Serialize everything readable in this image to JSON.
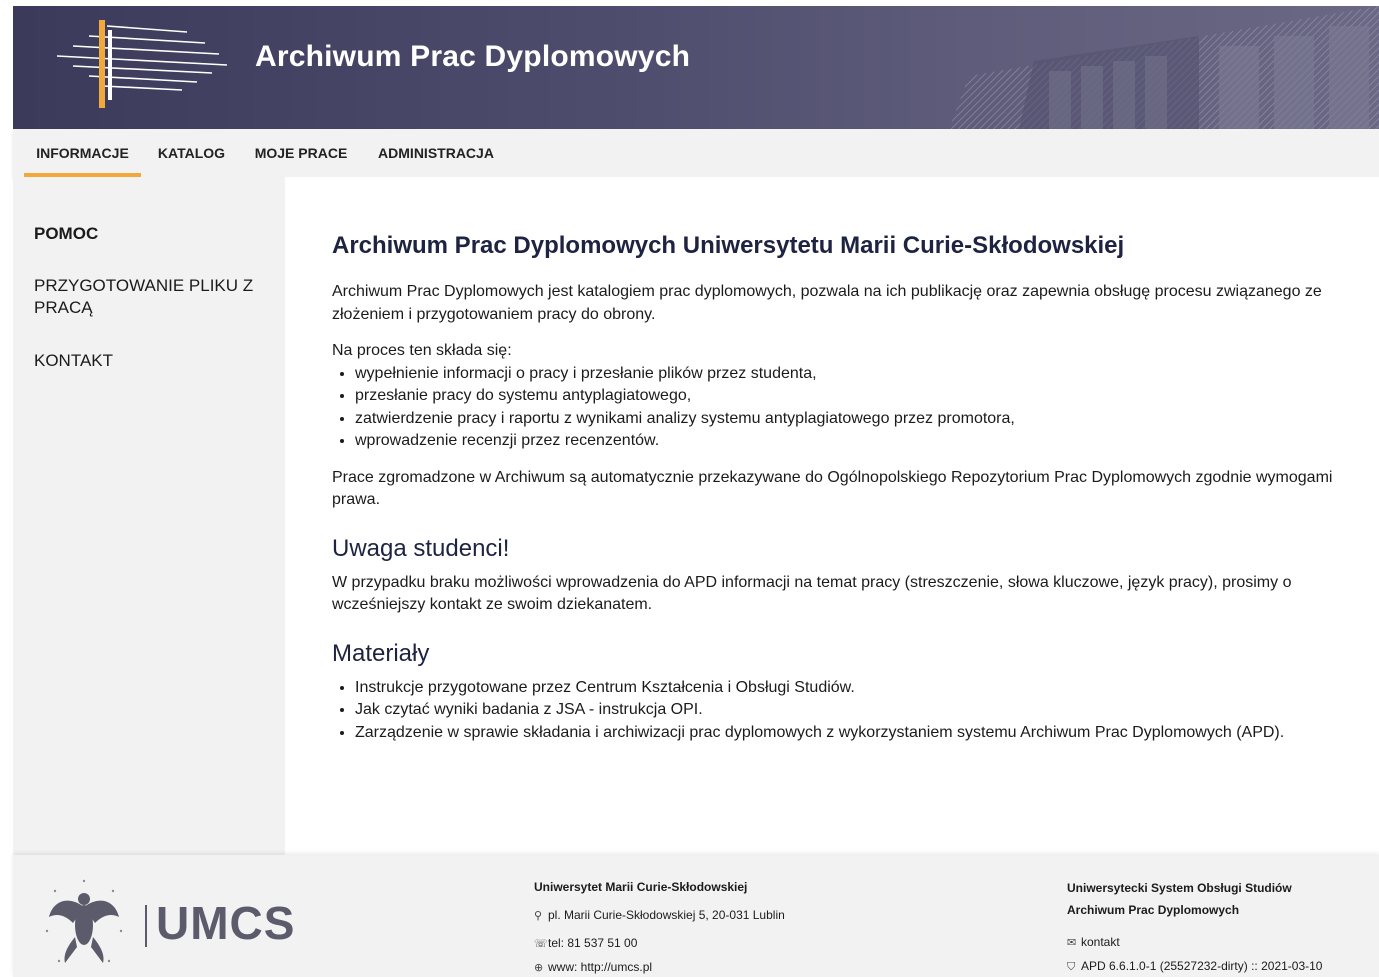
{
  "header": {
    "title": "Archiwum Prac Dyplomowych"
  },
  "nav": {
    "items": [
      {
        "label": "INFORMACJE",
        "active": true
      },
      {
        "label": "KATALOG"
      },
      {
        "label": "MOJE PRACE"
      },
      {
        "label": "ADMINISTRACJA"
      }
    ]
  },
  "sidebar": {
    "items": [
      {
        "label": "POMOC",
        "active": true
      },
      {
        "label": "PRZYGOTOWANIE PLIKU Z PRACĄ"
      },
      {
        "label": "KONTAKT"
      }
    ]
  },
  "main": {
    "title": "Archiwum Prac Dyplomowych Uniwersytetu Marii Curie-Skłodowskiej",
    "intro": "Archiwum Prac Dyplomowych jest katalogiem prac dyplomowych, pozwala na ich publikację oraz zapewnia obsługę procesu związanego ze złożeniem i przygotowaniem pracy do obrony.",
    "process_lead": "Na proces ten składa się:",
    "process_steps": [
      "wypełnienie informacji o pracy i przesłanie plików przez studenta,",
      "przesłanie pracy do systemu antyplagiatowego,",
      "zatwierdzenie pracy i raportu z wynikami analizy systemu antyplagiatowego przez promotora,",
      "wprowadzenie recenzji przez recenzentów."
    ],
    "repository_note": "Prace zgromadzone w Archiwum są automatycznie przekazywane do Ogólnopolskiego Repozytorium Prac Dyplomowych zgodnie wymogami prawa.",
    "notice_title": "Uwaga studenci!",
    "notice_text": "W przypadku braku możliwości wprowadzenia do APD informacji na temat pracy (streszczenie, słowa kluczowe, język pracy), prosimy o wcześniejszy kontakt ze swoim dziekanatem.",
    "materials_title": "Materiały",
    "materials": [
      "Instrukcje przygotowane przez Centrum Kształcenia i Obsługi Studiów.",
      "Jak czytać wyniki badania z JSA - instrukcja OPI.",
      "Zarządzenie w sprawie składania i archiwizacji prac dyplomowych z wykorzystaniem systemu Archiwum Prac Dyplomowych (APD)."
    ]
  },
  "footer": {
    "logo_text": "UMCS",
    "university": {
      "name": "Uniwersytet Marii Curie-Skłodowskiej",
      "address": "pl. Marii Curie-Skłodowskiej 5, 20-031 Lublin",
      "phone": "tel: 81 537 51 00",
      "www": "www: http://umcs.pl"
    },
    "system": {
      "name1": "Uniwersytecki System Obsługi Studiów",
      "name2": "Archiwum Prac Dyplomowych",
      "contact": "kontakt",
      "version": "APD 6.6.1.0-1 (25527232-dirty) :: 2021-03-10"
    }
  },
  "colors": {
    "accent": "#f2a93b",
    "header_bg": "#4a4868",
    "heading": "#1d2340"
  }
}
